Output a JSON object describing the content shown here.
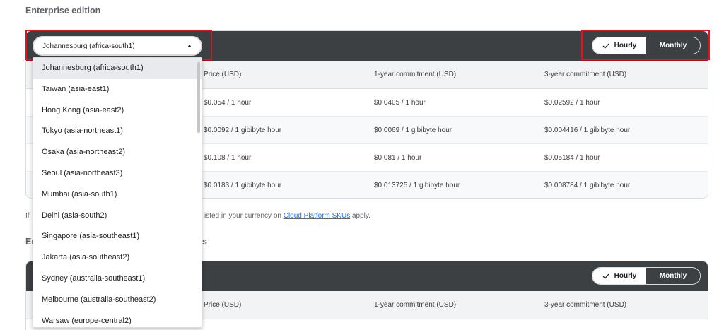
{
  "section1": {
    "title": "Enterprise edition",
    "region_select": {
      "value": "Johannesburg (africa-south1)"
    },
    "toggle": {
      "hourly": "Hourly",
      "monthly": "Monthly"
    },
    "columns": [
      "Price (USD)",
      "1-year commitment (USD)",
      "3-year commitment (USD)"
    ],
    "rows": [
      [
        "$0.054 / 1 hour",
        "$0.0405 / 1 hour",
        "$0.02592 / 1 hour"
      ],
      [
        "$0.0092 / 1 gibibyte hour",
        "$0.0069 / 1 gibibyte hour",
        "$0.004416 / 1 gibibyte hour"
      ],
      [
        "$0.108 / 1 hour",
        "$0.081 / 1 hour",
        "$0.05184 / 1 hour"
      ],
      [
        "$0.0183 / 1 gibibyte hour",
        "$0.013725 / 1 gibibyte hour",
        "$0.008784 / 1 gibibyte hour"
      ]
    ]
  },
  "note": {
    "lead": "If",
    "text": "isted in your currency on ",
    "link": "Cloud Platform SKUs",
    "tail": " apply."
  },
  "section2": {
    "title_left": "Er",
    "title_right": "s",
    "toggle": {
      "hourly": "Hourly",
      "monthly": "Monthly"
    },
    "columns": [
      "Price (USD)",
      "1-year commitment (USD)",
      "3-year commitment (USD)"
    ]
  },
  "dropdown": {
    "options": [
      "Johannesburg (africa-south1)",
      "Taiwan (asia-east1)",
      "Hong Kong (asia-east2)",
      "Tokyo (asia-northeast1)",
      "Osaka (asia-northeast2)",
      "Seoul (asia-northeast3)",
      "Mumbai (asia-south1)",
      "Delhi (asia-south2)",
      "Singapore (asia-southeast1)",
      "Jakarta (asia-southeast2)",
      "Sydney (australia-southeast1)",
      "Melbourne (australia-southeast2)",
      "Warsaw (europe-central2)"
    ]
  },
  "colors": {
    "bar": "#3c4043",
    "highlight": "#e0141e",
    "link": "#1a73e8"
  }
}
